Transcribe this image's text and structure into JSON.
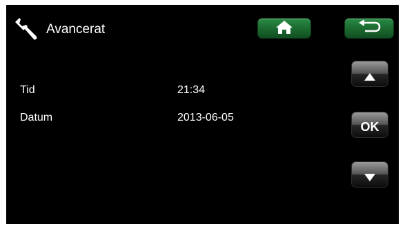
{
  "header": {
    "title": "Avancerat",
    "title_icon": "wrench-icon",
    "home_icon": "home-icon",
    "back_icon": "back-arrow-icon"
  },
  "rows": [
    {
      "label": "Tid",
      "value": "21:34"
    },
    {
      "label": "Datum",
      "value": "2013-06-05"
    }
  ],
  "side_buttons": {
    "up_icon": "triangle-up-icon",
    "ok_label": "OK",
    "down_icon": "triangle-down-icon"
  },
  "colors": {
    "background": "#000000",
    "text": "#ffffff",
    "header_button": "#1c6b31",
    "side_button": "#555555"
  }
}
